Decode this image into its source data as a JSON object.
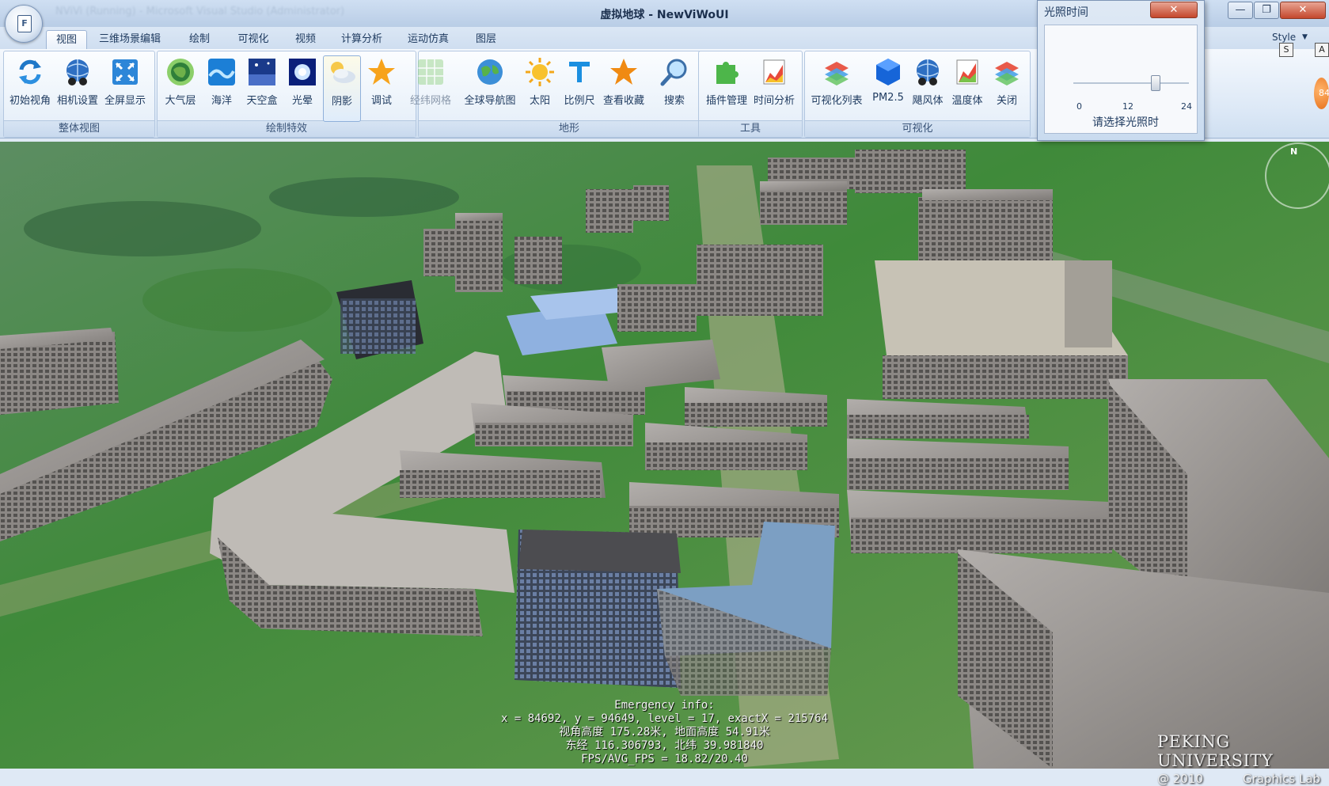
{
  "window": {
    "faded_title": "NViVi (Running) - Microsoft Visual Studio (Administrator)",
    "title": "虚拟地球 - NewViWoUI",
    "minimize_glyph": "—",
    "maximize_glyph": "❐",
    "close_glyph": "✕"
  },
  "app_menu": {
    "icon": "document-icon",
    "glyph": "F"
  },
  "tabs": [
    "视图",
    "三维场景编辑",
    "绘制",
    "可视化",
    "视频",
    "计算分析",
    "运动仿真",
    "图层"
  ],
  "active_tab": "视图",
  "style_menu": {
    "label": "Style"
  },
  "ribbon": {
    "groups": [
      {
        "label": "整体视图",
        "buttons": [
          {
            "label": "初始视角",
            "icon": "refresh-icon"
          },
          {
            "label": "相机设置",
            "icon": "camera-globe-icon"
          },
          {
            "label": "全屏显示",
            "icon": "fullscreen-icon"
          }
        ]
      },
      {
        "label": "绘制特效",
        "buttons": [
          {
            "label": "大气层",
            "icon": "atmosphere-icon"
          },
          {
            "label": "海洋",
            "icon": "ocean-icon"
          },
          {
            "label": "天空盒",
            "icon": "skybox-icon"
          },
          {
            "label": "光晕",
            "icon": "halo-icon"
          },
          {
            "label": "阴影",
            "icon": "shadow-icon",
            "selected": true
          },
          {
            "label": "调试",
            "icon": "star-icon"
          }
        ]
      },
      {
        "label": "地形",
        "buttons": [
          {
            "label": "经纬网格",
            "icon": "grid-map-icon",
            "disabled": true
          },
          {
            "label": "全球导航图",
            "icon": "globe-icon"
          },
          {
            "label": "太阳",
            "icon": "sun-icon"
          },
          {
            "label": "比例尺",
            "icon": "ruler-icon"
          },
          {
            "label": "查看收藏",
            "icon": "favorite-star-icon"
          },
          {
            "label": "搜索",
            "icon": "search-icon"
          }
        ]
      },
      {
        "label": "工具",
        "buttons": [
          {
            "label": "插件管理",
            "icon": "puzzle-icon"
          },
          {
            "label": "时间分析",
            "icon": "time-chart-icon"
          }
        ]
      },
      {
        "label": "可视化",
        "buttons": [
          {
            "label": "可视化列表",
            "icon": "layers-icon"
          },
          {
            "label": "PM2.5",
            "icon": "cube-icon"
          },
          {
            "label": "飓风体",
            "icon": "typhoon-globe-icon"
          },
          {
            "label": "温度体",
            "icon": "temperature-chart-icon"
          },
          {
            "label": "关闭",
            "icon": "close-layers-icon"
          }
        ]
      }
    ]
  },
  "light_dialog": {
    "title": "光照时间",
    "close_glyph": "✕",
    "slider": {
      "min": "0",
      "mid": "12",
      "max": "24",
      "value": 17
    },
    "caption": "请选择光照时"
  },
  "viewport": {
    "info": {
      "line1": "Emergency info:",
      "line2": "x = 84692, y = 94649, level = 17, exactX = 215764",
      "line3": "视角高度 175.28米, 地面高度 54.91米",
      "line4": "东经 116.306793, 北纬 39.981840",
      "line5": "FPS/AVG_FPS = 18.82/20.40"
    },
    "watermark": {
      "line1": "PEKING UNIVERSITY",
      "year": "@ 2010",
      "lab": "Graphics Lab"
    },
    "compass_label": "N",
    "side_badges": [
      "S",
      "A"
    ],
    "orange_badge": "84"
  }
}
